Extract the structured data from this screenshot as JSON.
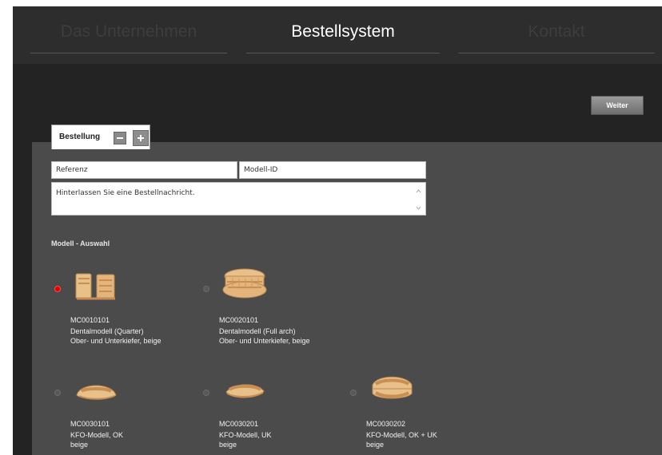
{
  "nav": {
    "items": [
      {
        "label": "Das Unternehmen",
        "active": false
      },
      {
        "label": "Bestellsystem",
        "active": true
      },
      {
        "label": "Kontakt",
        "active": false
      }
    ]
  },
  "actions": {
    "weiter_label": "Weiter"
  },
  "order_tab": {
    "label": "Bestellung"
  },
  "form": {
    "referenz_placeholder": "Referenz",
    "modell_id_placeholder": "Modell-ID",
    "message_placeholder": "Hinterlassen Sie eine Bestellnachricht."
  },
  "model_selection": {
    "title": "Modell - Auswahl",
    "selected_code": "MC0010101",
    "items": [
      {
        "code": "MC0010101",
        "name": "Dentalmodell (Quarter)",
        "desc": "Ober- und Unterkiefer, beige",
        "icon": "quarter-dental-model-icon"
      },
      {
        "code": "MC0020101",
        "name": "Dentalmodell (Full arch)",
        "desc": "Ober- und Unterkiefer, beige",
        "icon": "full-arch-dental-model-icon"
      },
      {
        "code": "MC0030101",
        "name": "KFO-Modell, OK",
        "desc": "beige",
        "icon": "kfo-upper-model-icon"
      },
      {
        "code": "MC0030201",
        "name": "KFO-Modell, UK",
        "desc": "beige",
        "icon": "kfo-lower-model-icon"
      },
      {
        "code": "MC0030202",
        "name": "KFO-Modell, OK + UK",
        "desc": "beige",
        "icon": "kfo-upper-lower-model-icon"
      }
    ]
  },
  "colors": {
    "background": "#232323",
    "nav_background": "#2d2d2d",
    "panel": "#4b4b4b",
    "selected_radio": "#e00000",
    "model_beige": "#e8c08a"
  }
}
